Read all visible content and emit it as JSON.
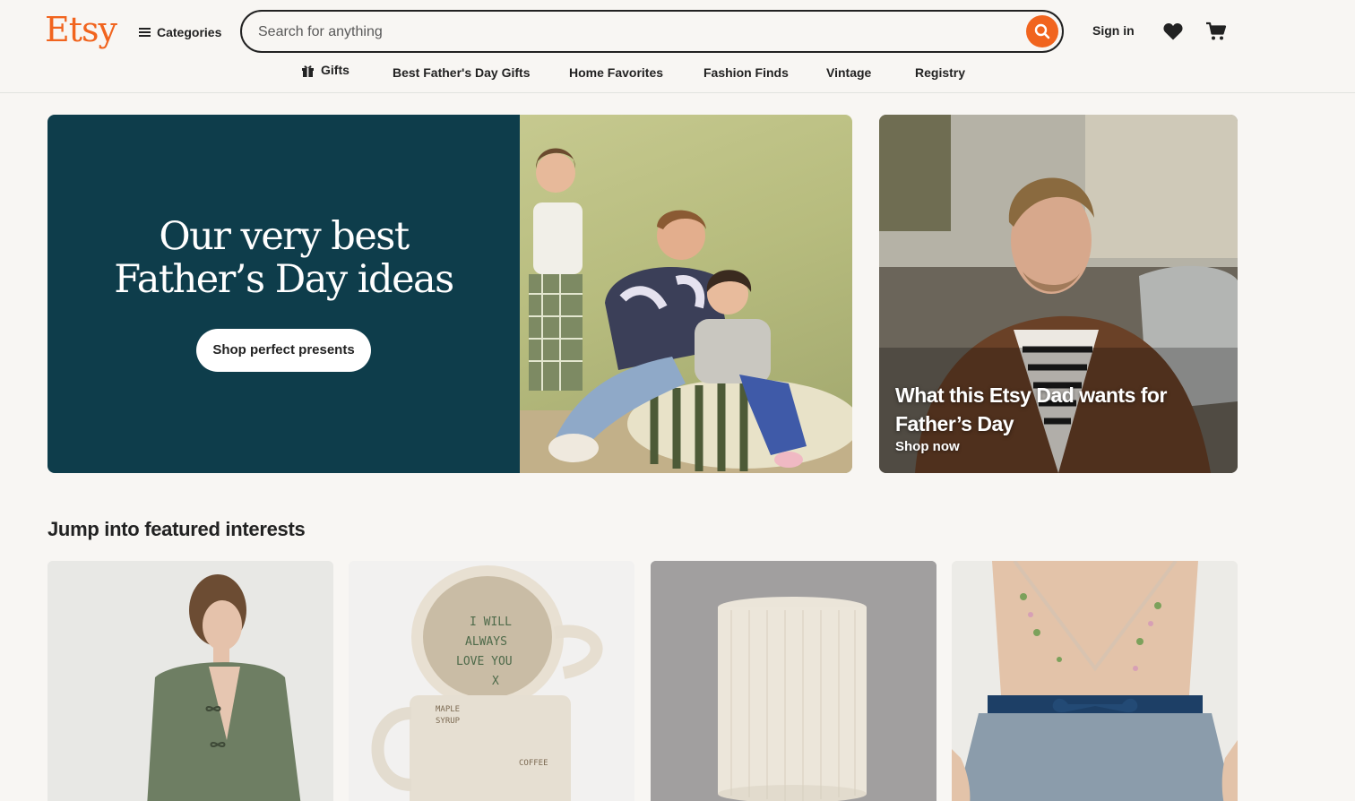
{
  "header": {
    "logo": "Etsy",
    "categories_label": "Categories",
    "search": {
      "placeholder": "Search for anything",
      "value": ""
    },
    "signin_label": "Sign in"
  },
  "nav": {
    "items": [
      {
        "label": "Gifts"
      },
      {
        "label": "Best Father's Day Gifts"
      },
      {
        "label": "Home Favorites"
      },
      {
        "label": "Fashion Finds"
      },
      {
        "label": "Vintage"
      },
      {
        "label": "Registry"
      }
    ]
  },
  "hero": {
    "title_line1": "Our very best",
    "title_line2": "Father’s Day ideas",
    "button_label": "Shop perfect presents",
    "bg_color": "#0e3d4b"
  },
  "side_card": {
    "title": "What this Etsy Dad wants for Father’s Day",
    "link_label": "Shop now"
  },
  "featured": {
    "title": "Jump into featured interests"
  },
  "colors": {
    "brand": "#f1641e",
    "background": "#f8f6f3",
    "text": "#222222"
  }
}
